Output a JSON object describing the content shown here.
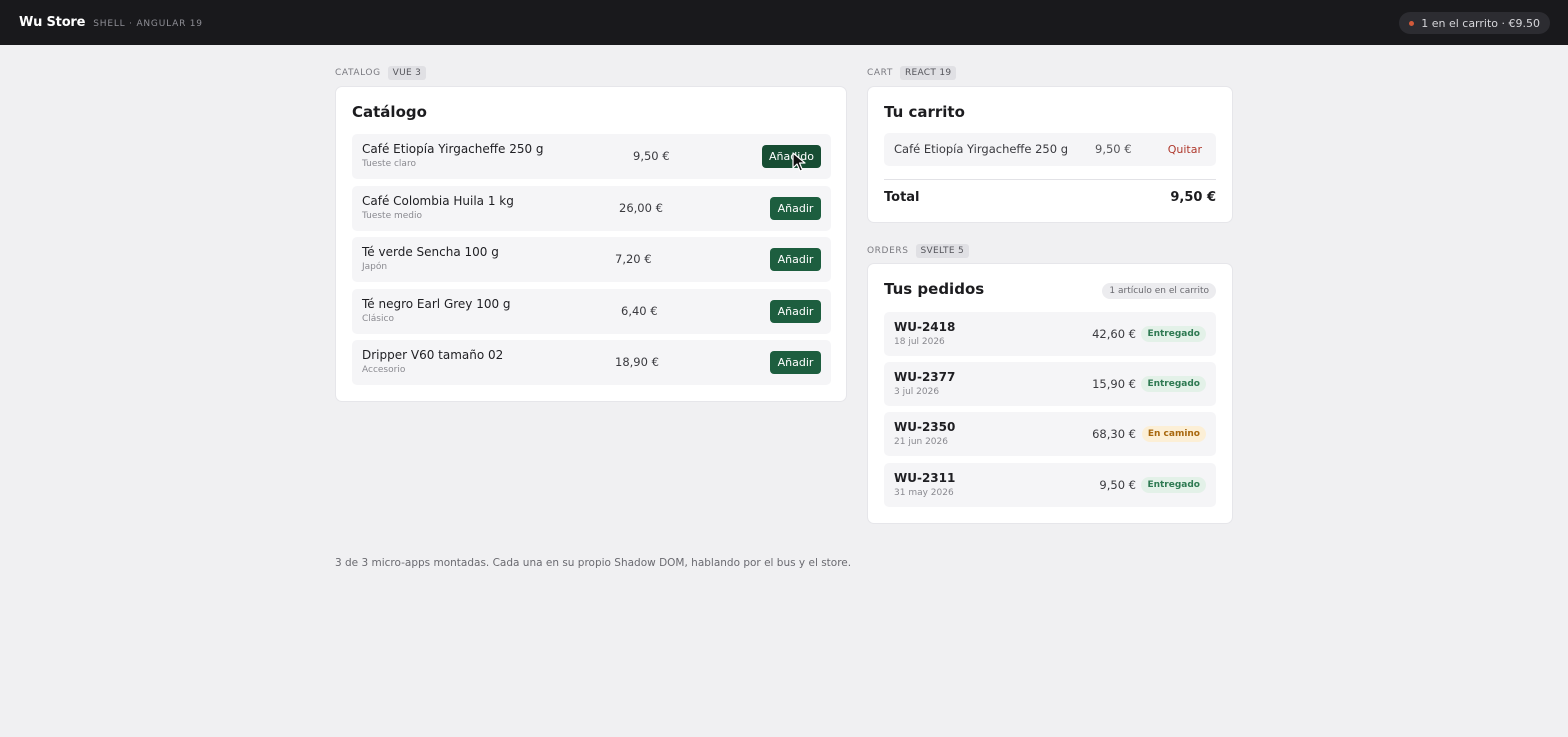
{
  "header": {
    "brand": "Wu Store",
    "subtitle": "SHELL · ANGULAR 19",
    "cart_status": "1 en el carrito · €9.50"
  },
  "catalog": {
    "section_label": "CATALOG",
    "framework": "VUE 3",
    "title": "Catálogo",
    "items": [
      {
        "name": "Café Etiopía Yirgacheffe 250 g",
        "sub": "Tueste claro",
        "price": "9,50 €",
        "button": "Añadido"
      },
      {
        "name": "Café Colombia Huila 1 kg",
        "sub": "Tueste medio",
        "price": "26,00 €",
        "button": "Añadir"
      },
      {
        "name": "Té verde Sencha 100 g",
        "sub": "Japón",
        "price": "7,20 €",
        "button": "Añadir"
      },
      {
        "name": "Té negro Earl Grey 100 g",
        "sub": "Clásico",
        "price": "6,40 €",
        "button": "Añadir"
      },
      {
        "name": "Dripper V60 tamaño 02",
        "sub": "Accesorio",
        "price": "18,90 €",
        "button": "Añadir"
      }
    ]
  },
  "cart": {
    "section_label": "CART",
    "framework": "REACT 19",
    "title": "Tu carrito",
    "items": [
      {
        "name": "Café Etiopía Yirgacheffe 250 g",
        "price": "9,50 €",
        "remove": "Quitar"
      }
    ],
    "total_label": "Total",
    "total_value": "9,50 €"
  },
  "orders": {
    "section_label": "ORDERS",
    "framework": "SVELTE 5",
    "title": "Tus pedidos",
    "count_badge": "1 artículo en el carrito",
    "items": [
      {
        "id": "WU-2418",
        "date": "18 jul 2026",
        "total": "42,60 €",
        "status": "Entregado"
      },
      {
        "id": "WU-2377",
        "date": "3 jul 2026",
        "total": "15,90 €",
        "status": "Entregado"
      },
      {
        "id": "WU-2350",
        "date": "21 jun 2026",
        "total": "68,30 €",
        "status": "En camino"
      },
      {
        "id": "WU-2311",
        "date": "31 may 2026",
        "total": "9,50 €",
        "status": "Entregado"
      }
    ]
  },
  "footer": {
    "note": "3 de 3 micro-apps montadas. Cada una en su propio Shadow DOM, hablando por el bus y el store."
  },
  "colors": {
    "topbar": "#19191c",
    "accent_green": "#1d5e3f",
    "remove_red": "#b03a2e",
    "status_delivered": "#2e7a52",
    "status_transit": "#a8680f"
  }
}
